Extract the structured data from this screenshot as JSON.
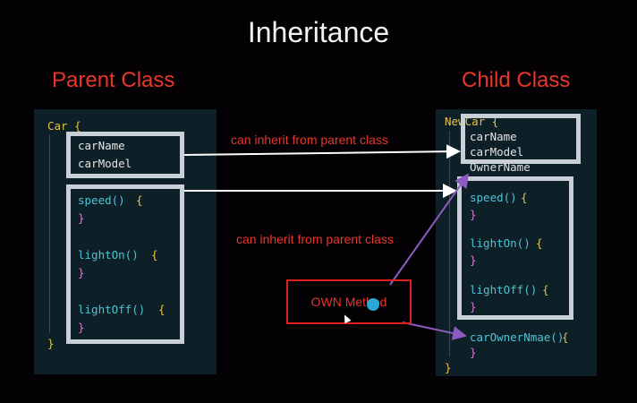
{
  "title": "Inheritance",
  "parent": {
    "heading": "Parent Class",
    "class_open": "Car {",
    "props": [
      "carName",
      "carModel"
    ],
    "methods": [
      "speed()",
      "lightOn()",
      "lightOff()"
    ],
    "brace_open": "{",
    "brace_close": "}",
    "class_close": "}"
  },
  "child": {
    "heading": "Child Class",
    "class_open": "NewCar {",
    "props": [
      "carName",
      "carModel",
      "OwnerName"
    ],
    "methods": [
      "speed()",
      "lightOn()",
      "lightOff()"
    ],
    "own_method": "carOwnerNmae()",
    "brace_open": "{",
    "brace_close": "}",
    "class_close": "}"
  },
  "annotations": {
    "inherit_props": "can inherit from parent class",
    "inherit_methods": "can inherit from parent class",
    "own_method": "OWN Method"
  },
  "colors": {
    "accent_red": "#e8362c",
    "arrow_white": "#ffffff",
    "arrow_purple": "#8e5bc0",
    "highlight_box": "#c9cfd6",
    "cursor_dot": "#2aa8d8"
  }
}
